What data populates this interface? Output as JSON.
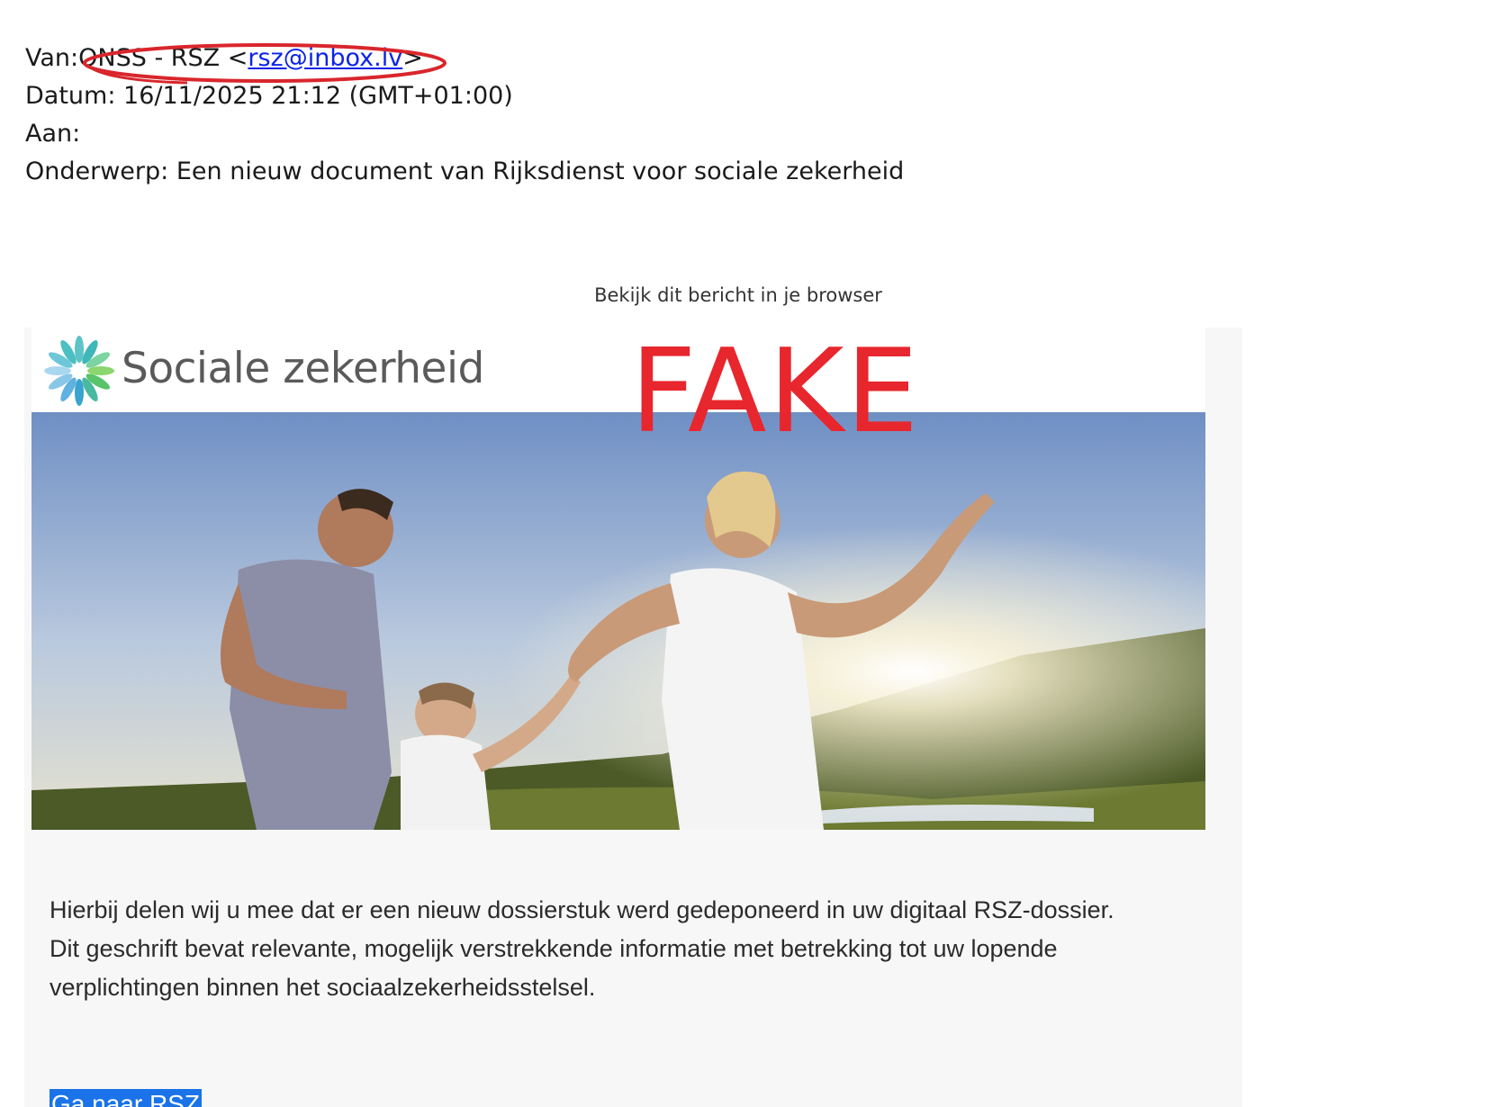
{
  "headers": {
    "from_label": "Van:",
    "from_name": "ONSS - RSZ <",
    "from_email": "rsz@inbox.lv",
    "from_close": ">",
    "date_label": "Datum:",
    "date_value": "16/11/2025 21:12 (GMT+01:00)",
    "to_label": "Aan:",
    "to_value": "",
    "subject_label": "Onderwerp:",
    "subject_value": "Een nieuw document van Rijksdienst voor sociale zekerheid"
  },
  "email": {
    "browser_link": "Bekijk dit bericht in je browser",
    "logo_text": "Sociale zekerheid",
    "stamp": "FAKE",
    "paragraph_1": "Hierbij delen wij u mee dat er een nieuw dossierstuk werd gedeponeerd in uw digitaal RSZ-dossier.",
    "paragraph_2": "Dit geschrift bevat relevante, mogelijk verstrekkende informatie met betrekking tot uw lopende verplichtingen binnen het sociaalzekerheidsstelsel.",
    "cta_label": "Ga naar RSZ"
  },
  "colors": {
    "link": "#0b24e8",
    "highlight_ellipse": "#d9262c",
    "stamp": "#e8262d",
    "selection": "#1a73e8",
    "card_bg": "#f7f7f7"
  },
  "icons": {
    "logo": "sociale-zekerheid-flower-icon"
  }
}
